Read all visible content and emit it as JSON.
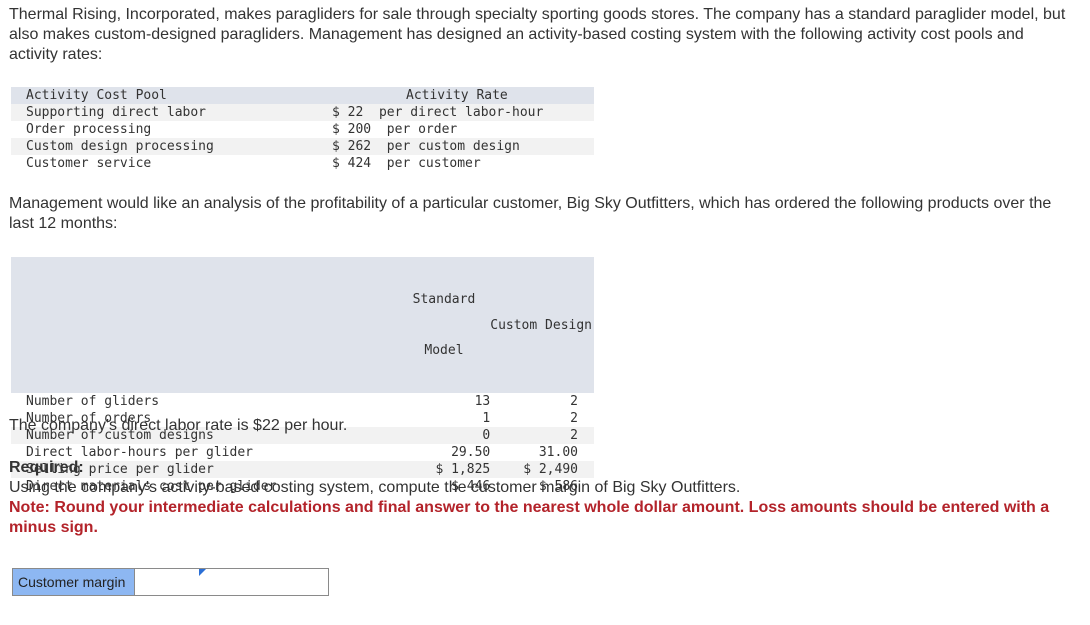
{
  "intro": "Thermal Rising, Incorporated, makes paragliders for sale through specialty sporting goods stores. The company has a standard paraglider model, but also makes custom-designed paragliders. Management has designed an activity-based costing system with the following activity cost pools and activity rates:",
  "rate_table": {
    "headers": {
      "pool": "Activity Cost Pool",
      "rate": "Activity Rate"
    },
    "rows": [
      {
        "pool": "Supporting direct labor",
        "rate": "$ 22  per direct labor-hour"
      },
      {
        "pool": "Order processing",
        "rate": "$ 200  per order"
      },
      {
        "pool": "Custom design processing",
        "rate": "$ 262  per custom design"
      },
      {
        "pool": "Customer service",
        "rate": "$ 424  per customer"
      }
    ]
  },
  "analysis_text": "Management would like an analysis of the profitability of a particular customer, Big Sky Outfitters, which has ordered the following products over the last 12 months:",
  "product_table": {
    "headers": {
      "standard_line1": "Standard",
      "standard_line2": "Model",
      "custom": "Custom Design"
    },
    "rows": [
      {
        "label": "Number of gliders",
        "standard": "13",
        "custom": "2"
      },
      {
        "label": "Number of orders",
        "standard": "1",
        "custom": "2"
      },
      {
        "label": "Number of custom designs",
        "standard": "0",
        "custom": "2"
      },
      {
        "label": "Direct labor-hours per glider",
        "standard": "29.50",
        "custom": "31.00"
      },
      {
        "label": "Selling price per glider",
        "standard": "$ 1,825",
        "custom": "$ 2,490"
      },
      {
        "label": "Direct materials cost per glider",
        "standard": "$ 446",
        "custom": "$ 586"
      }
    ]
  },
  "labor_rate_text": "The company's direct labor rate is $22 per hour.",
  "required": {
    "title": "Required:",
    "instruction": "Using the company's activity-based costing system, compute the customer margin of Big Sky Outfitters.",
    "note": "Note: Round your intermediate calculations and final answer to the nearest whole dollar amount. Loss amounts should be entered with a minus sign."
  },
  "answer": {
    "label": "Customer margin",
    "value": ""
  },
  "colors": {
    "header_bg": "#dfe3eb",
    "note_red": "#b3232a",
    "answer_label_bg": "#8db7f2"
  }
}
